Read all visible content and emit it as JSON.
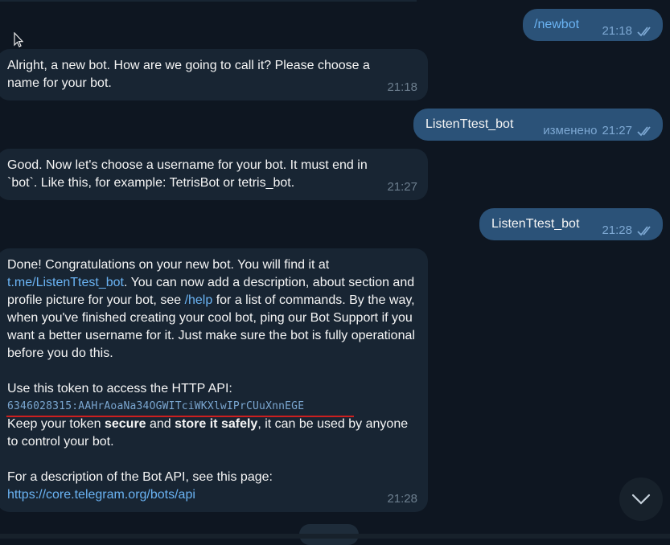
{
  "messages": {
    "m1": {
      "text": "/newbot",
      "time": "21:18"
    },
    "m2": {
      "text": "Alright, a new bot. How are we going to call it? Please choose a name for your bot.",
      "time": "21:18"
    },
    "m3": {
      "text": "ListenTtest_bot",
      "edited": "изменено",
      "time": "21:27"
    },
    "m4": {
      "text": "Good. Now let's choose a username for your bot. It must end in `bot`. Like this, for example: TetrisBot or tetris_bot.",
      "time": "21:27"
    },
    "m5": {
      "text": "ListenTtest_bot",
      "time": "21:28"
    },
    "m6": {
      "p1_a": "Done! Congratulations on your new bot. You will find it at ",
      "link_bot": "t.me/ListenTtest_bot",
      "p1_b": ". You can now add a description, about section and profile picture for your bot, see ",
      "link_help": "/help",
      "p1_c": " for a list of commands. By the way, when you've finished creating your cool bot, ping our Bot Support if you want a better username for it. Just make sure the bot is fully operational before you do this.",
      "token_intro": "Use this token to access the HTTP API:",
      "token": "6346028315:AAHrAoaNa34OGWITciWKXlwIPrCUuXnnEGE",
      "keep_a": "Keep your token ",
      "keep_b": "secure",
      "keep_c": " and ",
      "keep_d": "store it safely",
      "keep_e": ", it can be used by anyone to control your bot.",
      "desc": "For a description of the Bot API, see this page:",
      "link_api": "https://core.telegram.org/bots/api",
      "time": "21:28"
    }
  },
  "colors": {
    "background": "#0e1621",
    "incoming_bubble": "#182533",
    "outgoing_bubble": "#2b5278",
    "link": "#6ab3f3",
    "annotation_red": "#cc1f1f"
  },
  "icons": {
    "read": "double-check-icon",
    "scroll": "chevron-down-icon",
    "pointer": "mouse-cursor-icon"
  }
}
